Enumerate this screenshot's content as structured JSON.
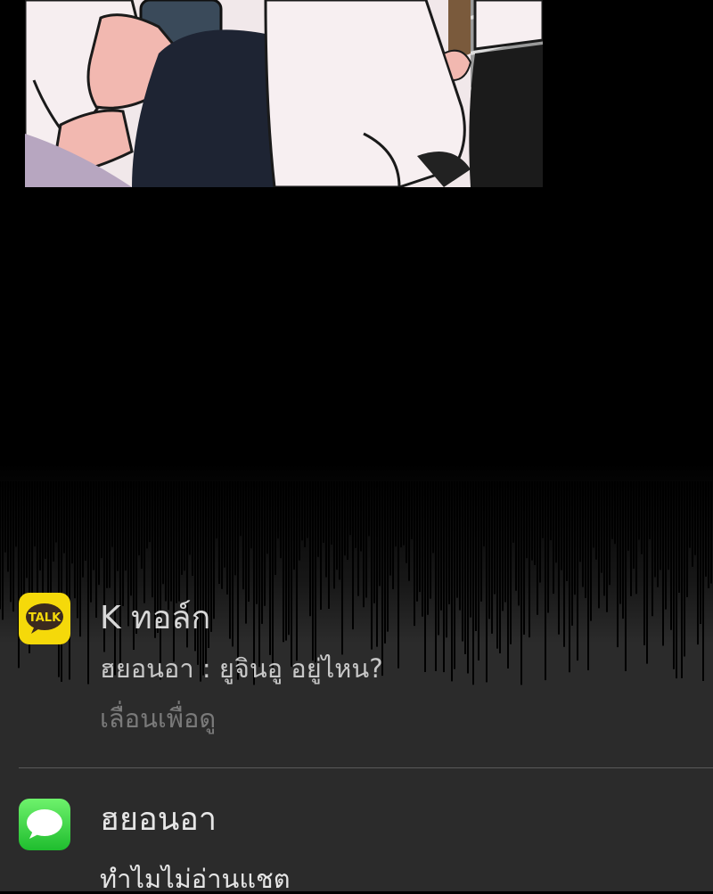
{
  "notifications": [
    {
      "app": "K ทอล์ก",
      "message": "ฮยอนอา : ยูจินอู อยู่ไหน?",
      "hint": "เลื่อนเพื่อดู",
      "icon": "kakaotalk-icon"
    },
    {
      "app": "ฮยอนอา",
      "message": "ทำไมไม่อ่านแชต",
      "icon": "messages-icon"
    }
  ],
  "colors": {
    "notification_bg": "#2b2b2b",
    "kakao_yellow": "#f5d90a",
    "messages_green": "#29c33a"
  }
}
